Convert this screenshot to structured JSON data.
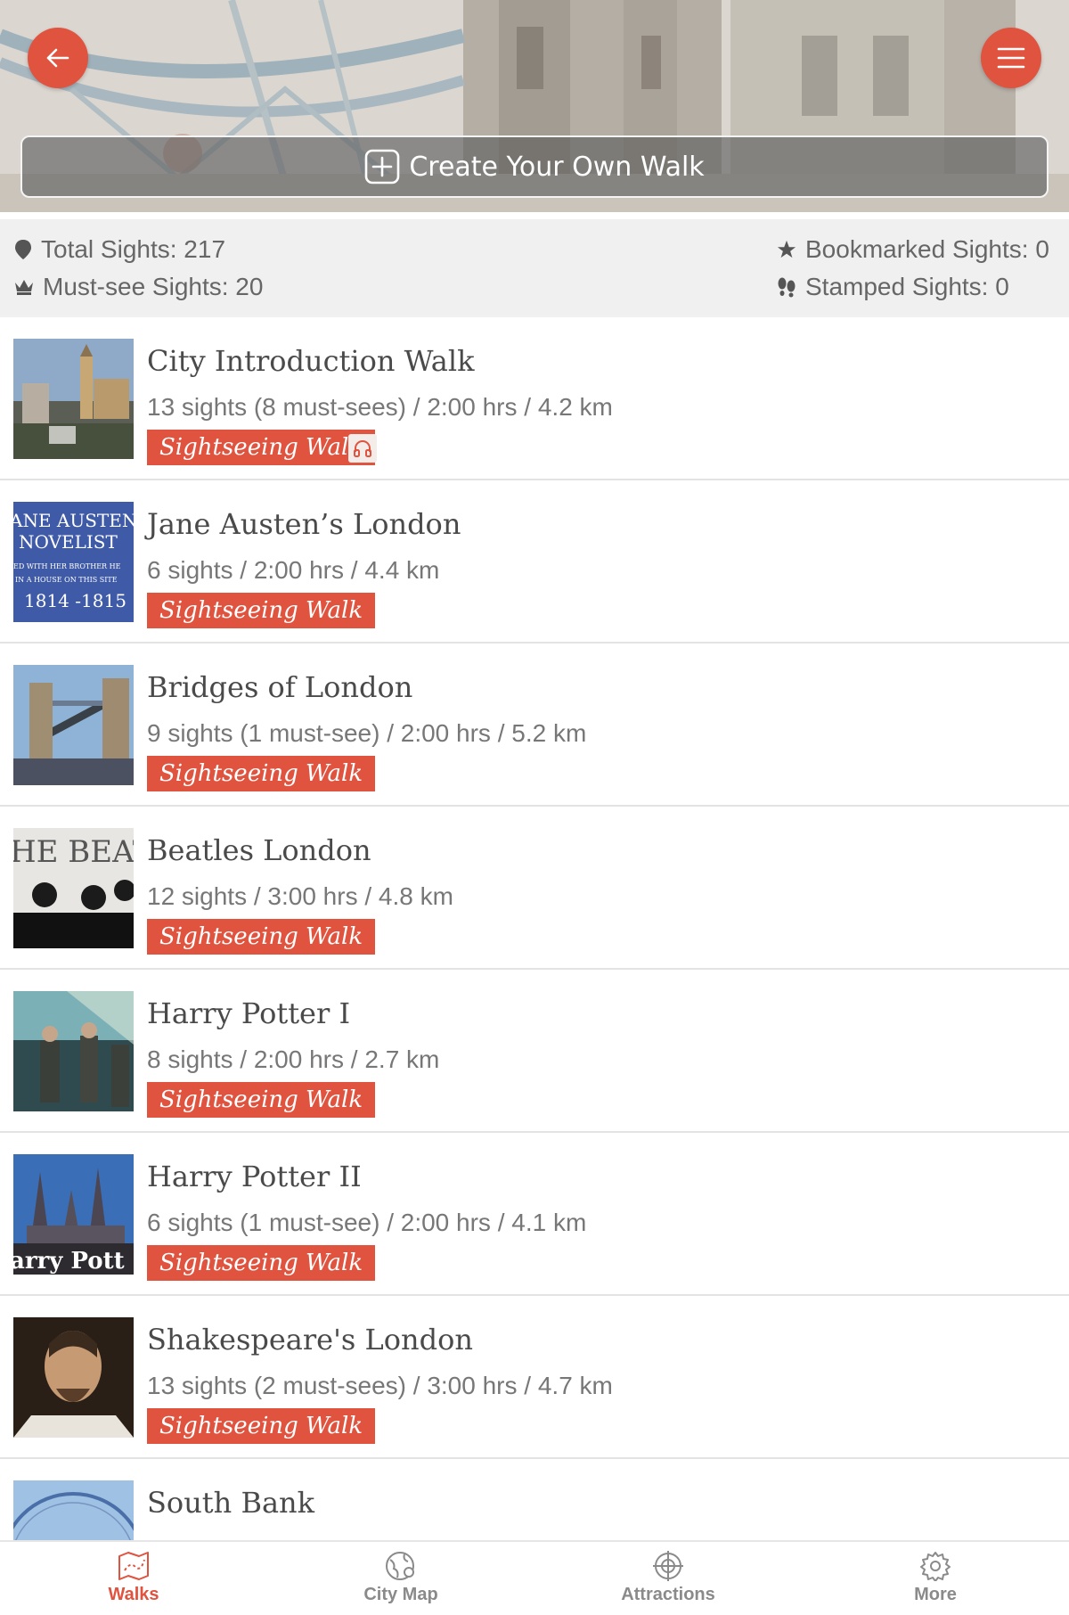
{
  "header": {
    "back_icon": "arrow-left-icon",
    "menu_icon": "hamburger-menu-icon",
    "create_walk_label": "Create Your Own Walk",
    "create_walk_icon": "plus-square-icon",
    "accent_color": "#e0533f"
  },
  "stats": {
    "total": "Total Sights: 217",
    "must_see": "Must-see Sights: 20",
    "bookmarked": "Bookmarked Sights: 0",
    "stamped": "Stamped Sights: 0"
  },
  "walks": [
    {
      "title": "City Introduction Walk",
      "meta": "13 sights (8 must-sees) / 2:00 hrs / 4.2 km",
      "tag": "Sightseeing Walk",
      "audio": true
    },
    {
      "title": "Jane Austen’s London",
      "meta": "6 sights / 2:00 hrs / 4.4 km",
      "tag": "Sightseeing Walk",
      "thumb_text": [
        "ANE AUSTEN",
        "NOVELIST",
        "ED WITH HER BROTHER HE",
        "IN A HOUSE ON THIS SITE",
        "1814 -1815"
      ]
    },
    {
      "title": "Bridges of London",
      "meta": "9 sights (1 must-see) / 2:00 hrs / 5.2 km",
      "tag": "Sightseeing Walk"
    },
    {
      "title": "Beatles London",
      "meta": "12 sights / 3:00 hrs / 4.8 km",
      "tag": "Sightseeing Walk",
      "thumb_text": [
        "HE BEATLI"
      ]
    },
    {
      "title": "Harry Potter I",
      "meta": "8 sights / 2:00 hrs / 2.7 km",
      "tag": "Sightseeing Walk"
    },
    {
      "title": "Harry Potter II",
      "meta": "6 sights (1 must-see) / 2:00 hrs / 4.1 km",
      "tag": "Sightseeing Walk",
      "thumb_text": [
        "arry Pott"
      ]
    },
    {
      "title": "Shakespeare's London",
      "meta": "13 sights (2 must-sees) / 3:00 hrs / 4.7 km",
      "tag": "Sightseeing Walk"
    },
    {
      "title": "South Bank",
      "meta": "",
      "tag": ""
    }
  ],
  "nav": {
    "items": [
      {
        "label": "Walks",
        "icon": "map-walks-icon",
        "active": true
      },
      {
        "label": "City Map",
        "icon": "globe-map-icon",
        "active": false
      },
      {
        "label": "Attractions",
        "icon": "crosshair-attractions-icon",
        "active": false
      },
      {
        "label": "More",
        "icon": "gear-icon",
        "active": false
      }
    ]
  }
}
